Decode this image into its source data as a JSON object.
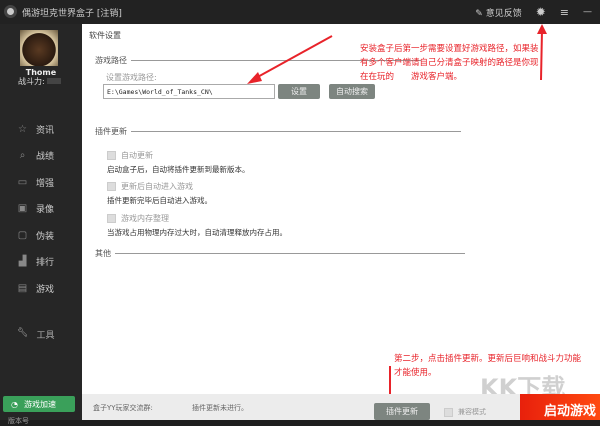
{
  "window": {
    "title": "偶游坦克世界盒子 [注销]",
    "feedback": "意见反馈"
  },
  "user": {
    "name": "Thome",
    "power_label": "战斗力:"
  },
  "sidebar": {
    "items": [
      {
        "label": "资讯",
        "icon": "star-icon"
      },
      {
        "label": "战绩",
        "icon": "search-icon"
      },
      {
        "label": "增强",
        "icon": "briefcase-icon"
      },
      {
        "label": "录像",
        "icon": "video-icon"
      },
      {
        "label": "伪装",
        "icon": "camo-icon"
      },
      {
        "label": "排行",
        "icon": "bar-chart-icon"
      },
      {
        "label": "游戏",
        "icon": "gamepad-icon"
      }
    ],
    "tools": "工具",
    "accelerate": "游戏加速",
    "version": "版本号"
  },
  "settings": {
    "title": "软件设置",
    "game_path": {
      "section": "游戏路径",
      "label": "设置游戏路径:",
      "value": "E:\\Games\\World_of_Tanks_CN\\",
      "set_btn": "设置",
      "auto_btn": "自动搜索"
    },
    "plugin": {
      "section": "插件更新",
      "options": [
        {
          "label": "自动更新",
          "desc": "启动盒子后，自动将插件更新到最新版本。",
          "checked": false
        },
        {
          "label": "更新后自动进入游戏",
          "desc": "插件更新完毕后自动进入游戏。",
          "checked": false
        },
        {
          "label": "游戏内存整理",
          "desc": "当游戏占用物理内存过大时，自动清理释放内存占用。",
          "checked": false
        }
      ]
    },
    "other": {
      "section": "其他"
    }
  },
  "annotations": {
    "step1": "安装盒子后第一步需要设置好游戏路径，如果装有多个客户端请自己分清盒子映射的路径是你现在在玩的　　游戏客户端。",
    "step2": "第二步，点击插件更新。更新后巨响和战斗力功能才能使用。"
  },
  "bottom": {
    "group": "盒子YY玩家交流群:",
    "status": "插件更新未进行。",
    "update_btn": "插件更新",
    "mode": "兼容模式",
    "start": "启动游戏"
  },
  "watermark": "KK下载"
}
